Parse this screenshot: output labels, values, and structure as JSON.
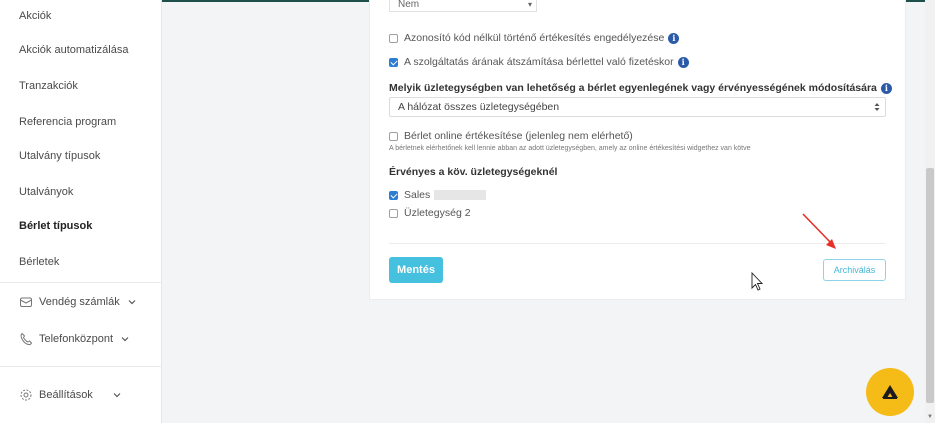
{
  "sidebar": {
    "items": [
      {
        "label": "Akciók"
      },
      {
        "label": "Akciók automatizálása"
      },
      {
        "label": "Tranzakciók"
      },
      {
        "label": "Referencia program"
      },
      {
        "label": "Utalvány típusok"
      },
      {
        "label": "Utalványok"
      },
      {
        "label": "Bérlet típusok",
        "active": true
      },
      {
        "label": "Bérletek"
      }
    ],
    "groups": {
      "invoices": {
        "label": "Vendég számlák",
        "icon": "receipt-icon"
      },
      "phone": {
        "label": "Telefonközpont",
        "icon": "phone-icon"
      },
      "settings": {
        "label": "Beállítások",
        "icon": "gear-icon"
      }
    }
  },
  "form": {
    "top_select_value": "Nem",
    "options": {
      "no_id_redeem": {
        "label": "Azonosító kód nélkül történő értékesítés engedélyezése",
        "checked": false
      },
      "recalc_price": {
        "label": "A szolgáltatás árának átszámítása bérlettel való fizetéskor",
        "checked": true
      }
    },
    "modify_location": {
      "heading": "Melyik üzletegységben van lehetőség a bérlet egyenlegének vagy érvényességének módosítására",
      "value": "A hálózat összes üzletegységében"
    },
    "online_redeem": {
      "label": "Bérlet online értékesítése (jelenleg nem elérhető)",
      "checked": false,
      "hint": "A bérletnek elérhetőnek kell lennie abban az adott üzletegységben, amely az online értékesítési widgethez van kötve"
    },
    "valid_units": {
      "heading": "Érvényes a köv. üzletegységeknél",
      "units": [
        {
          "label": "Sales",
          "checked": true
        },
        {
          "label": "Üzletegység 2",
          "checked": false
        }
      ]
    },
    "save_label": "Mentés",
    "archive_label": "Archiválás"
  },
  "colors": {
    "accent": "#45c0df",
    "checkbox": "#2d7dd2",
    "info": "#2a5aa8",
    "fab": "#f5bb17",
    "annotation_arrow": "#e8302a"
  }
}
